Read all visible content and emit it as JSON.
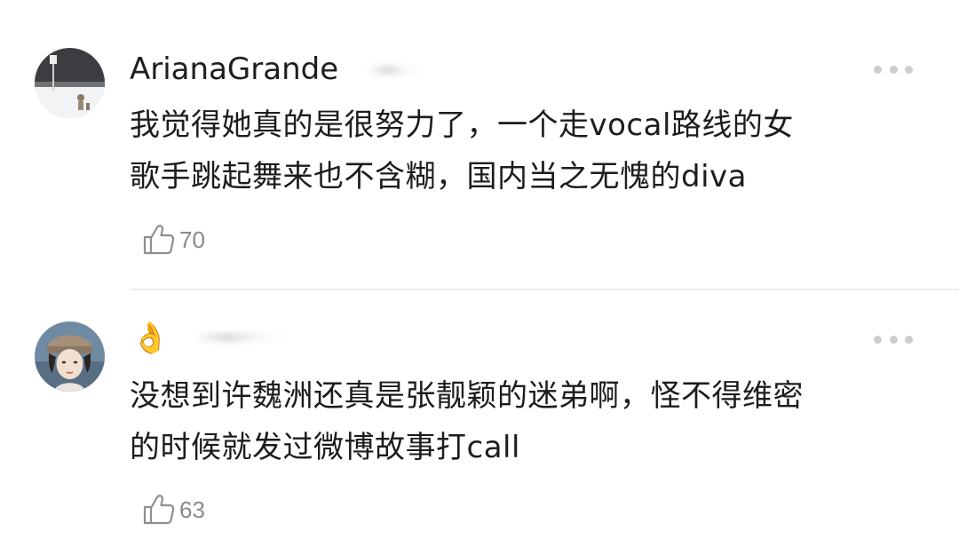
{
  "comments": [
    {
      "username": "ArianaGrande",
      "text_lines": [
        "我觉得她真的是很努力了，一个走vocal路线的女",
        "歌手跳起舞来也不含糊，国内当之无愧的diva"
      ],
      "likes": "70"
    },
    {
      "username": "",
      "name_emoji": "👌",
      "text_lines": [
        "没想到许魏洲还真是张靓颖的迷弟啊，怪不得维密",
        "的时候就发过微博故事打call"
      ],
      "likes": "63"
    }
  ],
  "colors": {
    "text": "#1c1c1c",
    "meta": "#8a8a8a",
    "divider": "#ececec",
    "more_dots": "#cdcdcd"
  },
  "icons": [
    "thumbs-up-icon",
    "more-dots-icon"
  ]
}
